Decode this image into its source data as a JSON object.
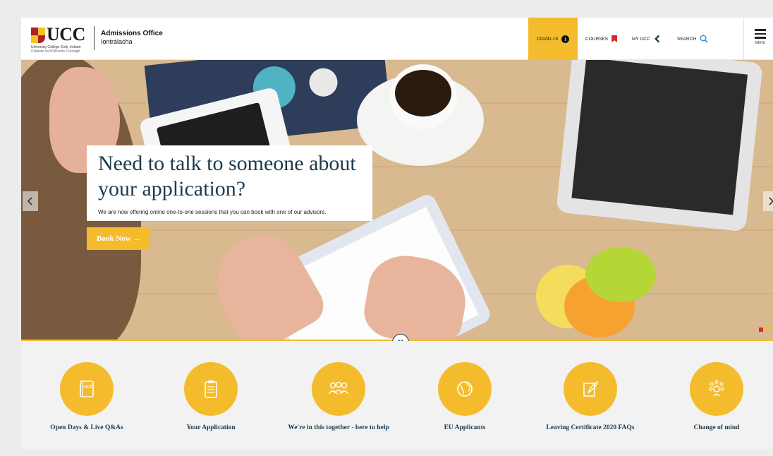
{
  "header": {
    "logo_text": "UCC",
    "logo_sub1": "University College Cork, Ireland",
    "logo_sub2": "Coláiste na hOllscoile Corcaigh",
    "office_title": "Admissions Office",
    "office_subtitle": "Iontrálacha",
    "nav": {
      "covid": "COVID-19",
      "courses": "COURSES",
      "myucc": "MY UCC",
      "search": "SEARCH",
      "menu": "MENU"
    }
  },
  "hero": {
    "title": "Need to talk to someone about your application?",
    "description": "We are now offering online one-to-one sessions that you can book with one of our advisors.",
    "button": "Book Now →",
    "slides_total": 2,
    "slide_active": 1
  },
  "quick_links": [
    {
      "label": "Open Days & Live Q&As",
      "icon": "book-icon"
    },
    {
      "label": "Your Application",
      "icon": "clipboard-icon"
    },
    {
      "label": "We're in this together - here to help",
      "icon": "people-icon"
    },
    {
      "label": "EU Applicants",
      "icon": "globe-icon"
    },
    {
      "label": "Leaving Certificate 2020 FAQs",
      "icon": "quill-icon"
    },
    {
      "label": "Change of mind",
      "icon": "idea-icon"
    }
  ],
  "colors": {
    "accent": "#f4bc2c",
    "navy": "#1d3a4d",
    "red": "#d9262e"
  }
}
